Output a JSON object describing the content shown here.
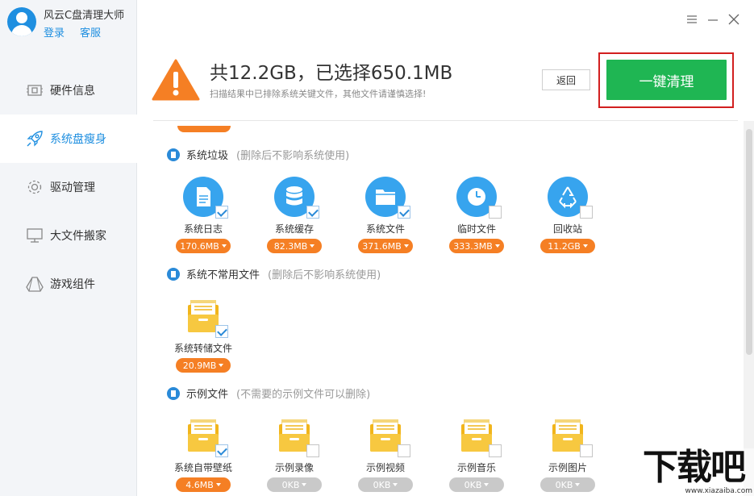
{
  "app": {
    "name": "风云C盘清理大师",
    "login_label": "登录",
    "support_label": "客服"
  },
  "sidebar": {
    "items": [
      {
        "label": "硬件信息",
        "icon": "hardware-icon",
        "active": false
      },
      {
        "label": "系统盘瘦身",
        "icon": "rocket-icon",
        "active": true
      },
      {
        "label": "驱动管理",
        "icon": "gear-icon",
        "active": false
      },
      {
        "label": "大文件搬家",
        "icon": "monitor-icon",
        "active": false
      },
      {
        "label": "游戏组件",
        "icon": "game-icon",
        "active": false
      }
    ]
  },
  "window": {
    "menu_icon": "menu-icon",
    "minimize_icon": "minimize-icon",
    "close_icon": "close-icon"
  },
  "header": {
    "title": "共12.2GB，已选择650.1MB",
    "subtitle": "扫描结果中已排除系统关键文件，其他文件请谨慎选择!",
    "back_label": "返回",
    "clean_label": "一键清理",
    "warning_icon": "warning-icon"
  },
  "sections": [
    {
      "title": "系统垃圾",
      "note": "(删除后不影响系统使用)",
      "items": [
        {
          "label": "系统日志",
          "size": "170.6MB",
          "checked": true,
          "icon": "log-file-icon"
        },
        {
          "label": "系统缓存",
          "size": "82.3MB",
          "checked": true,
          "icon": "database-icon"
        },
        {
          "label": "系统文件",
          "size": "371.6MB",
          "checked": true,
          "icon": "folder-icon"
        },
        {
          "label": "临时文件",
          "size": "333.3MB",
          "checked": false,
          "icon": "clock-icon"
        },
        {
          "label": "回收站",
          "size": "11.2GB",
          "checked": false,
          "icon": "recycle-icon"
        }
      ]
    },
    {
      "title": "系统不常用文件",
      "note": "(删除后不影响系统使用)",
      "items": [
        {
          "label": "系统转储文件",
          "size": "20.9MB",
          "checked": true,
          "icon": "archive-folder-icon"
        }
      ]
    },
    {
      "title": "示例文件",
      "note": "(不需要的示例文件可以删除)",
      "items": [
        {
          "label": "系统自带壁纸",
          "size": "4.6MB",
          "checked": true,
          "icon": "archive-folder-icon"
        },
        {
          "label": "示例录像",
          "size": "0KB",
          "checked": false,
          "icon": "archive-folder-icon"
        },
        {
          "label": "示例视频",
          "size": "0KB",
          "checked": false,
          "icon": "archive-folder-icon"
        },
        {
          "label": "示例音乐",
          "size": "0KB",
          "checked": false,
          "icon": "archive-folder-icon"
        },
        {
          "label": "示例图片",
          "size": "0KB",
          "checked": false,
          "icon": "archive-folder-icon"
        }
      ]
    }
  ],
  "watermark": {
    "text": "下载吧",
    "url": "www.xiazaiba.com"
  },
  "colors": {
    "accent": "#1f8fe0",
    "clean_button": "#1fb653",
    "size_pill": "#f57f24",
    "size_pill_empty": "#c9c9c9",
    "highlight_frame": "#d21f1f",
    "warning": "#f57f24"
  }
}
